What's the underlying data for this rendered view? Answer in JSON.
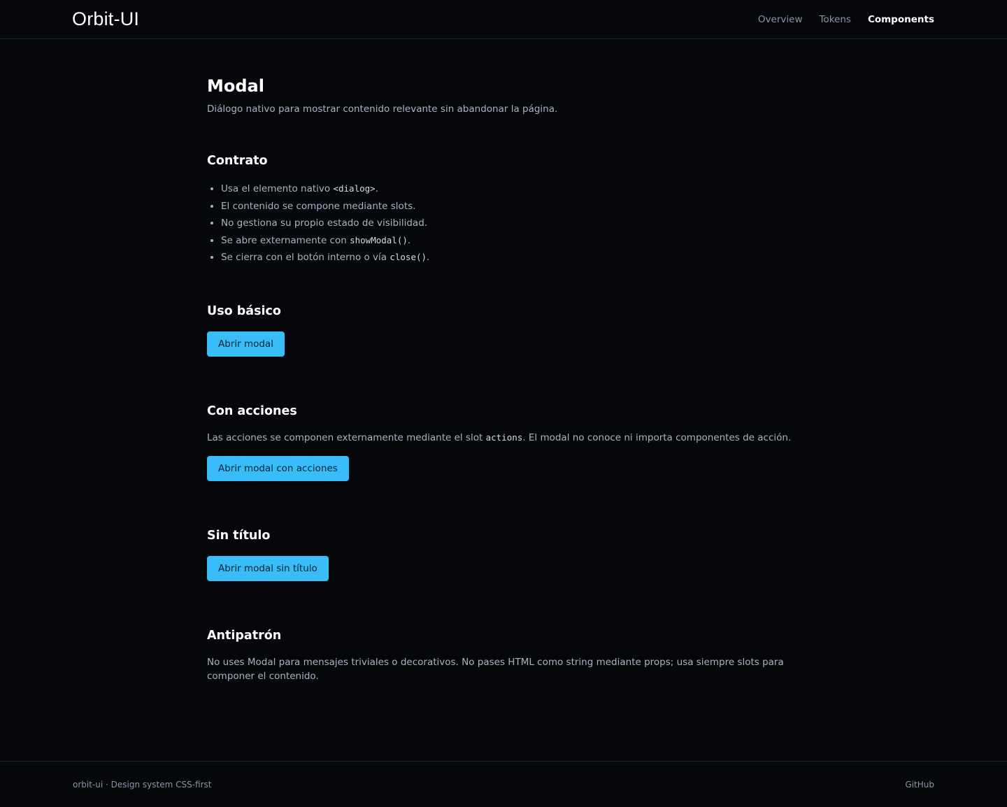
{
  "header": {
    "brand": "Orbit-UI",
    "nav": [
      {
        "label": "Overview"
      },
      {
        "label": "Tokens"
      },
      {
        "label": "Components"
      }
    ]
  },
  "page": {
    "title": "Modal",
    "description": "Diálogo nativo para mostrar contenido relevante sin abandonar la página."
  },
  "contrato": {
    "heading": "Contrato",
    "items": [
      {
        "pre": "Usa el elemento nativo ",
        "code": "<dialog>",
        "post": "."
      },
      {
        "pre": "El contenido se compone mediante slots.",
        "code": "",
        "post": ""
      },
      {
        "pre": "No gestiona su propio estado de visibilidad.",
        "code": "",
        "post": ""
      },
      {
        "pre": "Se abre externamente con ",
        "code": "showModal()",
        "post": "."
      },
      {
        "pre": "Se cierra con el botón interno o vía ",
        "code": "close()",
        "post": "."
      }
    ]
  },
  "uso_basico": {
    "heading": "Uso básico",
    "button": "Abrir modal"
  },
  "con_acciones": {
    "heading": "Con acciones",
    "text_pre": "Las acciones se componen externamente mediante el slot ",
    "text_code": "actions",
    "text_post": ". El modal no conoce ni importa componentes de acción.",
    "button": "Abrir modal con acciones"
  },
  "sin_titulo": {
    "heading": "Sin título",
    "button": "Abrir modal sin título"
  },
  "antipatron": {
    "heading": "Antipatrón",
    "text": "No uses Modal para mensajes triviales o decorativos. No pases HTML como string mediante props; usa siempre slots para componer el contenido."
  },
  "footer": {
    "left": "orbit-ui · Design system CSS-first",
    "right": "GitHub"
  },
  "colors": {
    "background": "#05070b",
    "accent": "#38bdf8",
    "text_muted": "#a9b3c2"
  }
}
